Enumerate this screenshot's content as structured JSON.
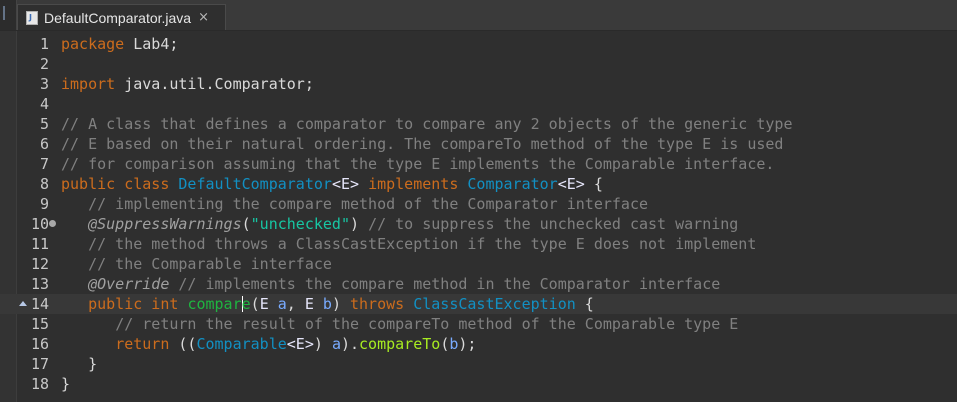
{
  "tab": {
    "title": "DefaultComparator.java",
    "close_glyph": "×"
  },
  "lines": [
    {
      "n": "1",
      "segments": [
        [
          "kw",
          "package"
        ],
        [
          "p",
          " Lab4;"
        ]
      ]
    },
    {
      "n": "2",
      "segments": []
    },
    {
      "n": "3",
      "segments": [
        [
          "kw",
          "import"
        ],
        [
          "p",
          " java.util.Comparator;"
        ]
      ]
    },
    {
      "n": "4",
      "segments": []
    },
    {
      "n": "5",
      "segments": [
        [
          "cm",
          "// A class that defines a comparator to compare any 2 objects of the generic type"
        ]
      ]
    },
    {
      "n": "6",
      "segments": [
        [
          "cm",
          "// E based on their natural ordering. The compareTo method of the type E is used"
        ]
      ]
    },
    {
      "n": "7",
      "segments": [
        [
          "cm",
          "// for comparison assuming that the type E implements the Comparable interface."
        ]
      ]
    },
    {
      "n": "8",
      "segments": [
        [
          "kw",
          "public class"
        ],
        [
          "p",
          " "
        ],
        [
          "ty",
          "DefaultComparator"
        ],
        [
          "op",
          "<E>"
        ],
        [
          "p",
          " "
        ],
        [
          "kw",
          "implements"
        ],
        [
          "p",
          " "
        ],
        [
          "ty",
          "Comparator"
        ],
        [
          "op",
          "<E>"
        ],
        [
          "p",
          " {"
        ]
      ]
    },
    {
      "n": "9",
      "segments": [
        [
          "p",
          "   "
        ],
        [
          "cm",
          "// implementing the compare method of the Comparator interface"
        ]
      ]
    },
    {
      "n": "10",
      "marker": "dot",
      "segments": [
        [
          "p",
          "   "
        ],
        [
          "an",
          "@SuppressWarnings"
        ],
        [
          "p",
          "("
        ],
        [
          "st",
          "\"unchecked\""
        ],
        [
          "p",
          ") "
        ],
        [
          "cm",
          "// to suppress the unchecked cast warning"
        ]
      ]
    },
    {
      "n": "11",
      "segments": [
        [
          "p",
          "   "
        ],
        [
          "cm",
          "// the method throws a ClassCastException if the type E does not implement"
        ]
      ]
    },
    {
      "n": "12",
      "segments": [
        [
          "p",
          "   "
        ],
        [
          "cm",
          "// the Comparable interface"
        ]
      ]
    },
    {
      "n": "13",
      "segments": [
        [
          "p",
          "   "
        ],
        [
          "an",
          "@Override"
        ],
        [
          "p",
          " "
        ],
        [
          "cm",
          "// implements the compare method in the Comparator interface"
        ]
      ]
    },
    {
      "n": "14",
      "marker": "override",
      "current": true,
      "segments": [
        [
          "p",
          "   "
        ],
        [
          "kw",
          "public int"
        ],
        [
          "p",
          " "
        ],
        [
          "me",
          "compar"
        ],
        [
          "caret",
          ""
        ],
        [
          "me",
          "e"
        ],
        [
          "p",
          "("
        ],
        [
          "op",
          "E"
        ],
        [
          "p",
          " "
        ],
        [
          "pr",
          "a"
        ],
        [
          "p",
          ", "
        ],
        [
          "op",
          "E"
        ],
        [
          "p",
          " "
        ],
        [
          "pr",
          "b"
        ],
        [
          "p",
          ") "
        ],
        [
          "kw",
          "throws"
        ],
        [
          "p",
          " "
        ],
        [
          "ty",
          "ClassCastException"
        ],
        [
          "p",
          " {"
        ]
      ]
    },
    {
      "n": "15",
      "segments": [
        [
          "p",
          "      "
        ],
        [
          "cm",
          "// return the result of the compareTo method of the Comparable type E"
        ]
      ]
    },
    {
      "n": "16",
      "segments": [
        [
          "p",
          "      "
        ],
        [
          "kw",
          "return"
        ],
        [
          "p",
          " (("
        ],
        [
          "ty",
          "Comparable"
        ],
        [
          "op",
          "<E>"
        ],
        [
          "p",
          ") "
        ],
        [
          "pr",
          "a"
        ],
        [
          "p",
          ")."
        ],
        [
          "mc",
          "compareTo"
        ],
        [
          "p",
          "("
        ],
        [
          "pr",
          "b"
        ],
        [
          "p",
          ");"
        ]
      ]
    },
    {
      "n": "17",
      "segments": [
        [
          "p",
          "   }"
        ]
      ]
    },
    {
      "n": "18",
      "segments": [
        [
          "p",
          "}"
        ]
      ]
    }
  ]
}
